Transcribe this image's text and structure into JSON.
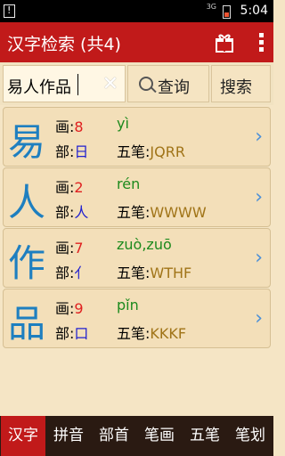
{
  "status": {
    "network": "3G",
    "time": "5:04"
  },
  "appbar": {
    "title": "汉字检索 (共4)"
  },
  "search": {
    "value": "易人作品",
    "query_label": "查询",
    "search_label": "搜索"
  },
  "labels": {
    "strokes": "画:",
    "radical": "部:",
    "wubi": "五笔:"
  },
  "results": [
    {
      "char": "易",
      "strokes": "8",
      "radical": "日",
      "pinyin": "yì",
      "wubi": "JQRR"
    },
    {
      "char": "人",
      "strokes": "2",
      "radical": "人",
      "pinyin": "rén",
      "wubi": "WWWW"
    },
    {
      "char": "作",
      "strokes": "7",
      "radical": "亻",
      "pinyin": "zuò,zuō",
      "wubi": "WTHF"
    },
    {
      "char": "品",
      "strokes": "9",
      "radical": "口",
      "pinyin": "pǐn",
      "wubi": "KKKF"
    }
  ],
  "tabs": [
    "汉字",
    "拼音",
    "部首",
    "笔画",
    "五笔",
    "笔划"
  ]
}
